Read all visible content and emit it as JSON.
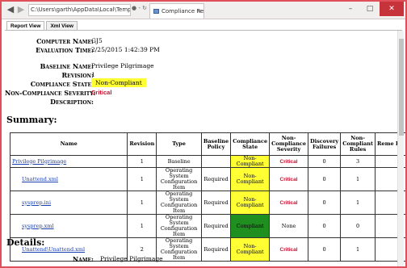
{
  "browser": {
    "address": "C:\\Users\\garth\\AppData\\Local\\Temp\\co",
    "address_icons": "● - ↻",
    "tab_title": "Compliance Report",
    "tab_close": "×",
    "back": "◀",
    "forward": "▶",
    "minimize": "–",
    "maximize": "□",
    "close": "✕"
  },
  "view_tabs": [
    "Report View",
    "Xml View"
  ],
  "info": {
    "computer_name_label": "Computer Name:",
    "computer_name": "GJ5",
    "evaluation_time_label": "Evaluation Time:",
    "evaluation_time": "2/25/2015 1:42:39 PM",
    "baseline_name_label": "Baseline Name:",
    "baseline_name": "Privilege Pilgrimage",
    "revision_label": "Revision:",
    "revision": "1",
    "compliance_state_label": "Compliance State:",
    "compliance_state": "Non-Compliant",
    "severity_label": "Non-Compliance Severity:",
    "severity": "Critical",
    "description_label": "Description:",
    "description": ""
  },
  "summary": {
    "heading": "Summary:",
    "headers": [
      "Name",
      "Revision",
      "Type",
      "Baseline Policy",
      "Compliance State",
      "Non-Compliance Severity",
      "Discovery Failures",
      "Non-Compliant Rules",
      "Reme Ru"
    ],
    "rows": [
      {
        "name": "Privilege Pilgrimage",
        "revision": "1",
        "type": "Baseline",
        "policy": "",
        "state": "Non-Compliant",
        "severity": "Critical",
        "failures": "0",
        "rules": "3"
      },
      {
        "name": "Unattend.xml",
        "revision": "1",
        "type": "Operating System Configuration Item",
        "policy": "Required",
        "state": "Non-Compliant",
        "severity": "Critical",
        "failures": "0",
        "rules": "1"
      },
      {
        "name": "sysprep.ini",
        "revision": "1",
        "type": "Operating System Configuration Item",
        "policy": "Required",
        "state": "Non-Compliant",
        "severity": "Critical",
        "failures": "0",
        "rules": "1"
      },
      {
        "name": "sysprep.xml",
        "revision": "1",
        "type": "Operating System Configuration Item",
        "policy": "Required",
        "state": "Compliant",
        "severity": "None",
        "failures": "0",
        "rules": "0"
      },
      {
        "name": "Unattend\\Unattend.xml",
        "revision": "2",
        "type": "Operating System Configuration Item",
        "policy": "Required",
        "state": "Non-Compliant",
        "severity": "Critical",
        "failures": "0",
        "rules": "1"
      }
    ]
  },
  "details": {
    "heading": "Details:",
    "name_label": "Name:",
    "name_value": "Privilege Pilgrimage"
  },
  "colors": {
    "non_compliant": "#ffff33",
    "compliant": "#1f8f1f",
    "critical": "#c8102e",
    "link": "#1a3fb0",
    "frame": "#e0505a"
  }
}
